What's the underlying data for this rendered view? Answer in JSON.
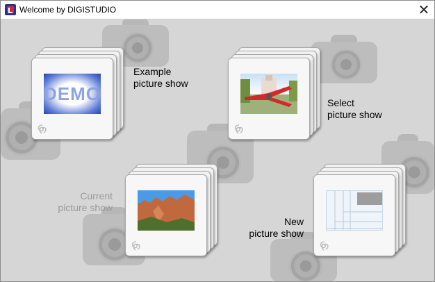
{
  "window": {
    "title": "Welcome by DIGISTUDIO",
    "close_glyph": "✕",
    "app_icon": "digistudio-app-icon"
  },
  "options": {
    "example": {
      "label": "Example\npicture show",
      "thumb_text": "DEMO",
      "enabled": true
    },
    "select": {
      "label": "Select\npicture show",
      "enabled": true
    },
    "current": {
      "label": "Current\npicture show",
      "enabled": false
    },
    "new": {
      "label": "New\npicture show",
      "enabled": true
    }
  },
  "icons": {
    "slide_logo": "digistudio-knot-logo",
    "background": "camera-icon"
  },
  "colors": {
    "background": "#d6d6d6",
    "slide": "#f2f2f2",
    "disabled_text": "#9a9a9a"
  }
}
